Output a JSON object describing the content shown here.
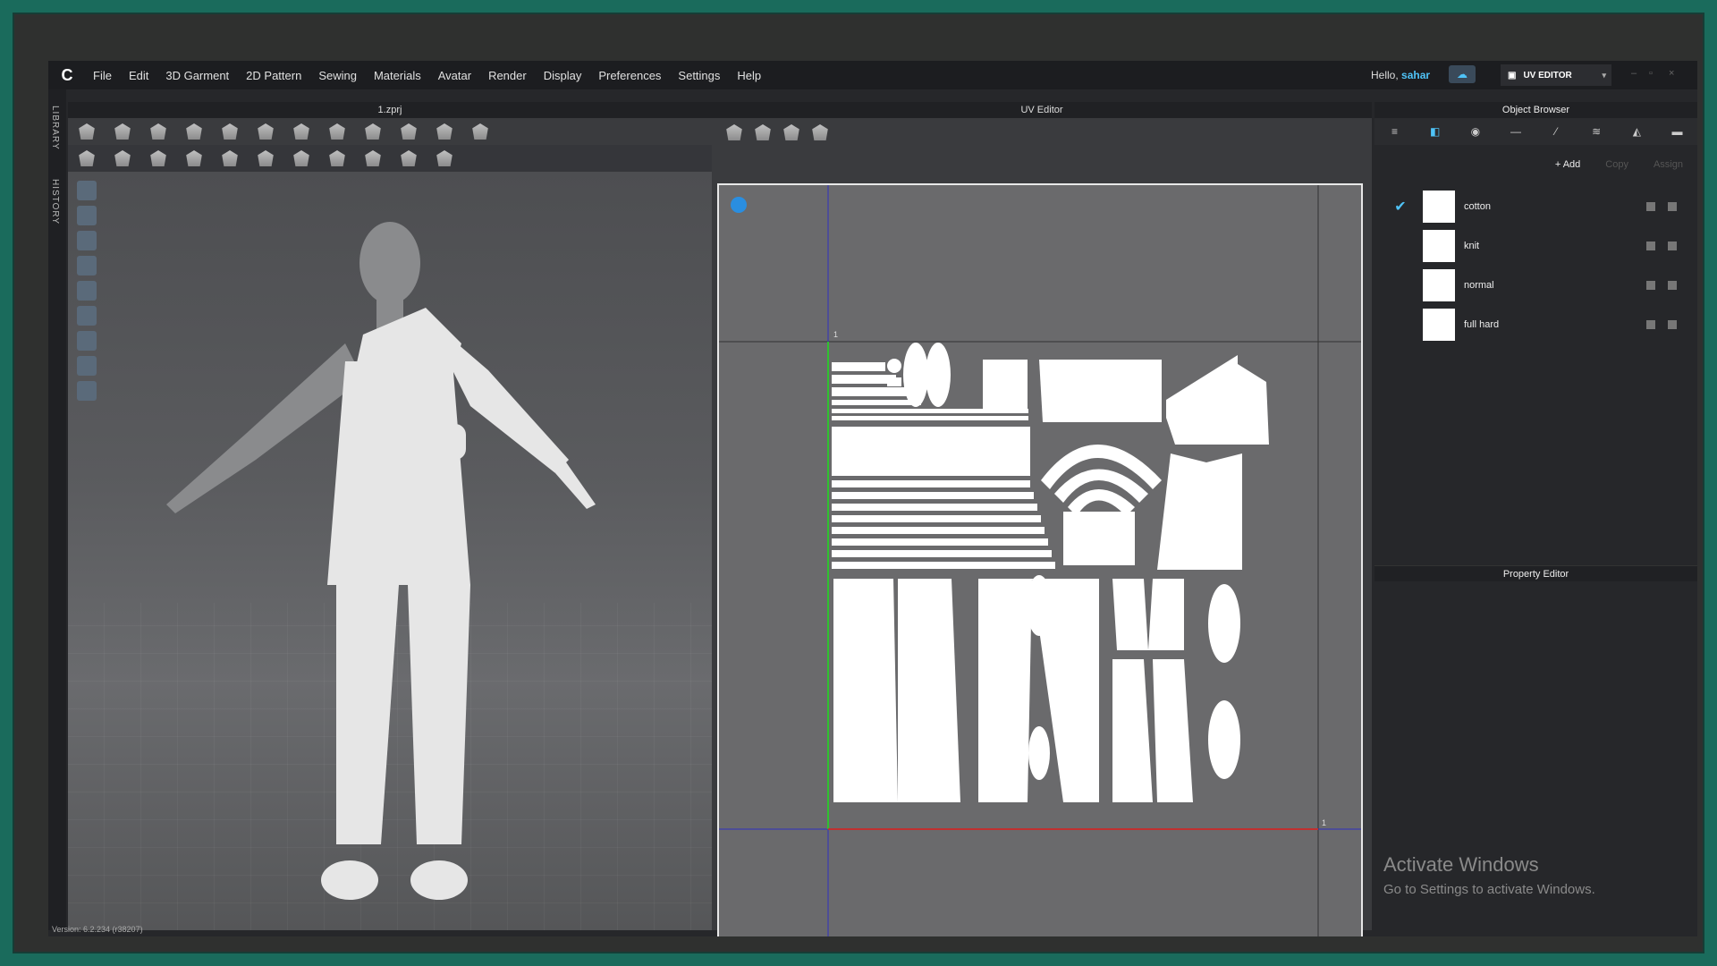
{
  "menubar": {
    "items": [
      "File",
      "Edit",
      "3D Garment",
      "2D Pattern",
      "Sewing",
      "Materials",
      "Avatar",
      "Render",
      "Display",
      "Preferences",
      "Settings",
      "Help"
    ],
    "hello_label": "Hello,",
    "user_name": "sahar",
    "mode_label": "UV EDITOR"
  },
  "left_strip": {
    "library": "LIBRARY",
    "history": "HISTORY"
  },
  "viewport3d": {
    "title": "1.zprj"
  },
  "uv_editor": {
    "title": "UV Editor",
    "axis_label_top": "1",
    "axis_label_right": "1"
  },
  "object_browser": {
    "title": "Object Browser",
    "actions": {
      "add": "+ Add",
      "copy": "Copy",
      "assign": "Assign"
    },
    "fabrics": [
      {
        "name": "cotton",
        "selected": true
      },
      {
        "name": "knit",
        "selected": false
      },
      {
        "name": "normal",
        "selected": false
      },
      {
        "name": "full hard",
        "selected": false
      }
    ]
  },
  "property_editor": {
    "title": "Property Editor"
  },
  "watermark": {
    "line1": "Activate Windows",
    "line2": "Go to Settings to activate Windows."
  },
  "status": {
    "version": "Version: 6.2.234 (r38207)"
  },
  "colors": {
    "accent": "#4fc3f7",
    "teal_border": "#1a6b5c"
  }
}
